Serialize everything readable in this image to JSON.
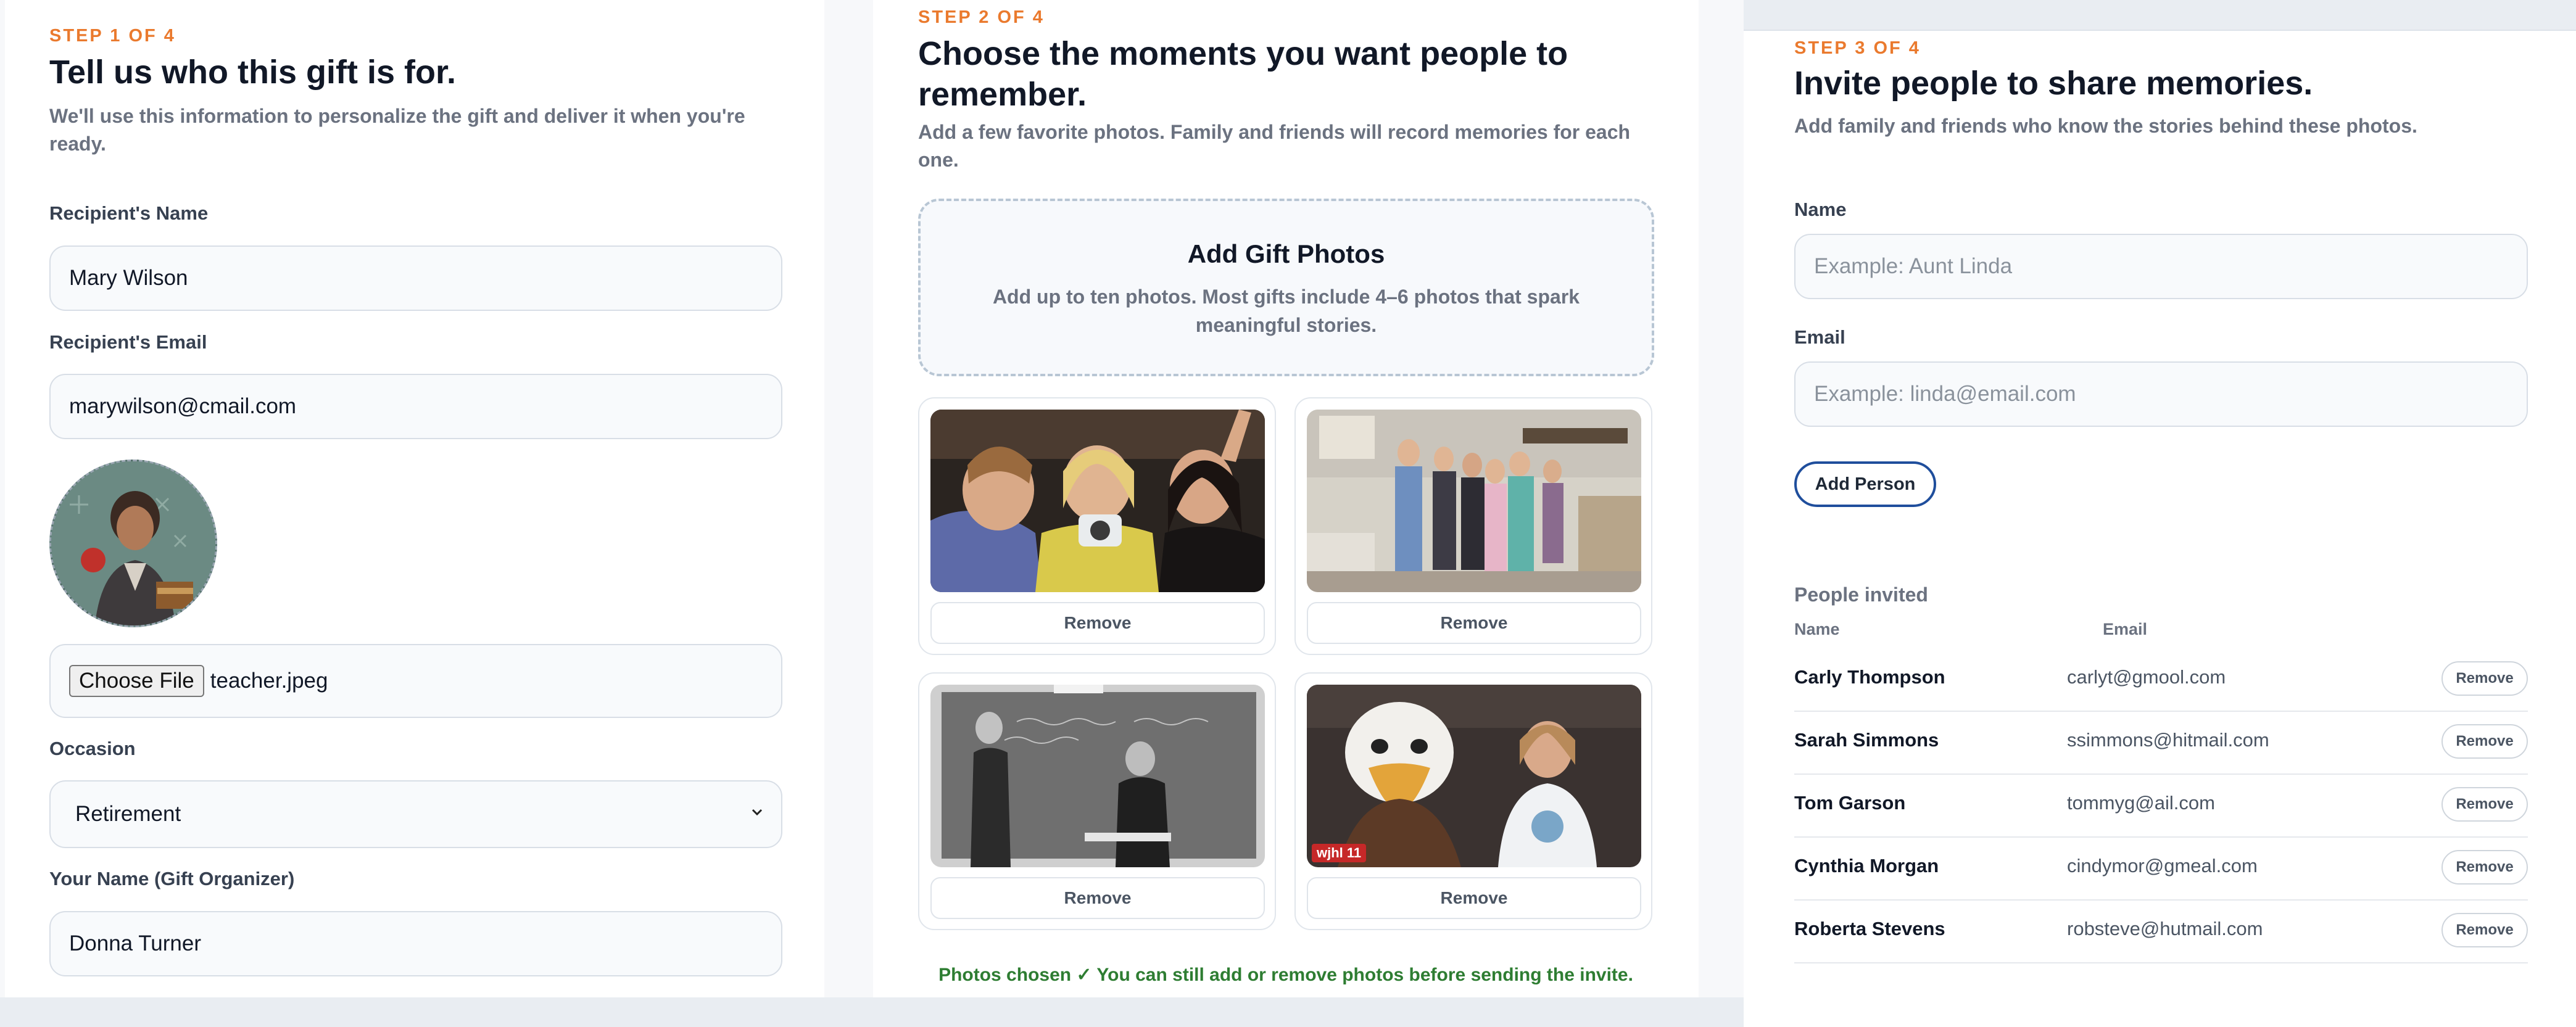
{
  "step1": {
    "step_label": "STEP 1 OF 4",
    "title": "Tell us who this gift is for.",
    "subtitle_line1": "We'll use this information to personalize the gift and deliver it when you're",
    "subtitle_line2": "ready.",
    "recipient_name_label": "Recipient's Name",
    "recipient_name_value": "Mary Wilson",
    "recipient_email_label": "Recipient's Email",
    "recipient_email_value": "marywilson@cmail.com",
    "choose_file_label": "Choose File",
    "file_name": "teacher.jpeg",
    "occasion_label": "Occasion",
    "occasion_value": "Retirement",
    "organizer_label": "Your Name (Gift Organizer)",
    "organizer_value": "Donna Turner"
  },
  "step2": {
    "step_label": "STEP 2 OF 4",
    "title_line1": "Choose the moments you want people to",
    "title_line2": "remember.",
    "subtitle_line1": "Add a few favorite photos. Family and friends will record memories for each",
    "subtitle_line2": "one.",
    "dropzone_title": "Add Gift Photos",
    "dropzone_text_line1": "Add up to ten photos. Most gifts include 4–6 photos that spark",
    "dropzone_text_line2": "meaningful stories.",
    "photos": [
      {
        "remove_label": "Remove"
      },
      {
        "remove_label": "Remove"
      },
      {
        "remove_label": "Remove"
      },
      {
        "remove_label": "Remove",
        "badge": "wjhl 11"
      }
    ],
    "success_message": "Photos chosen ✓ You can still add or remove photos before sending the invite."
  },
  "step3": {
    "step_label": "STEP 3 OF 4",
    "title": "Invite people to share memories.",
    "subtitle": "Add family and friends who know the stories behind these photos.",
    "name_label": "Name",
    "name_placeholder": "Example: Aunt Linda",
    "email_label": "Email",
    "email_placeholder": "Example: linda@email.com",
    "add_person_label": "Add Person",
    "invited_heading": "People invited",
    "col_name": "Name",
    "col_email": "Email",
    "invited": [
      {
        "name": "Carly Thompson",
        "email": "carlyt@gmool.com",
        "remove": "Remove"
      },
      {
        "name": "Sarah Simmons",
        "email": "ssimmons@hitmail.com",
        "remove": "Remove"
      },
      {
        "name": "Tom Garson",
        "email": "tommyg@ail.com",
        "remove": "Remove"
      },
      {
        "name": "Cynthia Morgan",
        "email": "cindymor@gmeal.com",
        "remove": "Remove"
      },
      {
        "name": "Roberta Stevens",
        "email": "robsteve@hutmail.com",
        "remove": "Remove"
      }
    ]
  },
  "colors": {
    "accent_orange": "#ea7a2e",
    "button_outline_blue": "#1f4e9c",
    "success_green": "#2e7d32"
  }
}
